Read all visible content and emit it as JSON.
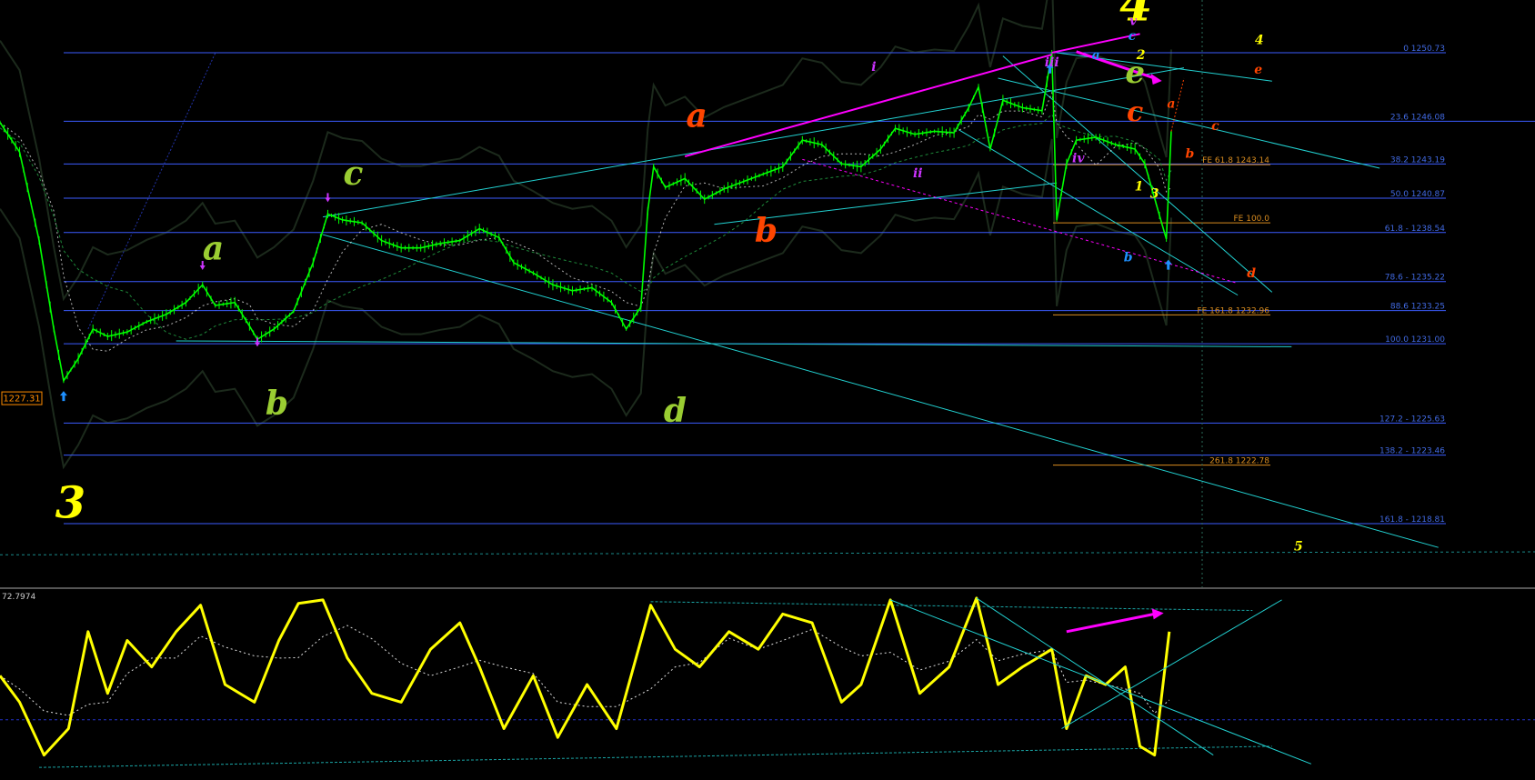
{
  "chart_data": {
    "type": "line",
    "colors": {
      "background": "#000000",
      "candles": "#00ff00",
      "fib": "#3b5bff",
      "fib_label": "#4169e1",
      "channel": "#22d3d3",
      "wave_path": "#ff00ff",
      "oscillator": "#ffff00",
      "fe": "#d98c1f",
      "price_box": "#ff8c00"
    },
    "price_pane": {
      "ylim": [
        1214.5,
        1254.3
      ],
      "fib_levels": [
        {
          "label": "0 1250.73",
          "value": 1250.73
        },
        {
          "label": "23.6 1246.08",
          "value": 1246.08
        },
        {
          "label": "38.2 1243.19",
          "value": 1243.19
        },
        {
          "label": "50.0 1240.87",
          "value": 1240.87
        },
        {
          "label": "61.8 - 1238.54",
          "value": 1238.54
        },
        {
          "label": "78.6 - 1235.22",
          "value": 1235.22
        },
        {
          "label": "88.6 1233.25",
          "value": 1233.25
        },
        {
          "label": "100.0 1231.00",
          "value": 1231.0
        },
        {
          "label": "127.2 - 1225.63",
          "value": 1225.63
        },
        {
          "label": "138.2 - 1223.46",
          "value": 1223.46
        },
        {
          "label": "161.8 - 1218.81",
          "value": 1218.81
        }
      ],
      "fe_levels": [
        {
          "label": "FE 61.8 1243.14",
          "value": 1243.14
        },
        {
          "label": "FE 100.0",
          "value": 1239.2
        },
        {
          "label": "FE 161.8 1232.96",
          "value": 1232.96
        },
        {
          "label": "261.8 1222.78",
          "value": 1222.78
        }
      ],
      "price_box": "1227.31",
      "price_series": [
        [
          0,
          1246
        ],
        [
          20,
          1244
        ],
        [
          40,
          1238
        ],
        [
          55,
          1232
        ],
        [
          65,
          1228.5
        ],
        [
          80,
          1230
        ],
        [
          95,
          1232
        ],
        [
          110,
          1231.5
        ],
        [
          130,
          1231.8
        ],
        [
          150,
          1232.5
        ],
        [
          170,
          1233
        ],
        [
          190,
          1233.8
        ],
        [
          207,
          1235
        ],
        [
          220,
          1233.6
        ],
        [
          240,
          1233.8
        ],
        [
          255,
          1232.2
        ],
        [
          263,
          1231.3
        ],
        [
          280,
          1232
        ],
        [
          300,
          1233.2
        ],
        [
          320,
          1236.5
        ],
        [
          335,
          1239.8
        ],
        [
          350,
          1239.4
        ],
        [
          370,
          1239.2
        ],
        [
          390,
          1238
        ],
        [
          410,
          1237.5
        ],
        [
          430,
          1237.5
        ],
        [
          450,
          1237.8
        ],
        [
          470,
          1238
        ],
        [
          490,
          1238.8
        ],
        [
          510,
          1238.2
        ],
        [
          525,
          1236.5
        ],
        [
          545,
          1235.8
        ],
        [
          565,
          1235
        ],
        [
          585,
          1234.6
        ],
        [
          605,
          1234.8
        ],
        [
          625,
          1233.8
        ],
        [
          640,
          1232
        ],
        [
          655,
          1233.5
        ],
        [
          662,
          1240
        ],
        [
          668,
          1243
        ],
        [
          680,
          1241.6
        ],
        [
          700,
          1242.2
        ],
        [
          720,
          1240.8
        ],
        [
          740,
          1241.5
        ],
        [
          760,
          1242
        ],
        [
          780,
          1242.5
        ],
        [
          800,
          1243
        ],
        [
          820,
          1244.8
        ],
        [
          840,
          1244.5
        ],
        [
          860,
          1243.2
        ],
        [
          880,
          1243
        ],
        [
          900,
          1244.2
        ],
        [
          915,
          1245.6
        ],
        [
          935,
          1245.2
        ],
        [
          955,
          1245.4
        ],
        [
          975,
          1245.3
        ],
        [
          990,
          1247
        ],
        [
          1000,
          1248.4
        ],
        [
          1012,
          1244.2
        ],
        [
          1025,
          1247.5
        ],
        [
          1045,
          1247
        ],
        [
          1065,
          1246.8
        ],
        [
          1075,
          1250.73
        ],
        [
          1080,
          1239.4
        ],
        [
          1090,
          1243.2
        ],
        [
          1100,
          1244.8
        ],
        [
          1120,
          1245
        ],
        [
          1140,
          1244.5
        ],
        [
          1160,
          1244.2
        ],
        [
          1170,
          1243.2
        ],
        [
          1185,
          1239.7
        ],
        [
          1192,
          1238.1
        ],
        [
          1197,
          1245.4
        ]
      ],
      "channels": [
        {
          "name": "upper-channel",
          "from": [
            330,
            1239.6
          ],
          "to": [
            1210,
            1249.7
          ]
        },
        {
          "name": "lower-channel",
          "from": [
            330,
            1238.4
          ],
          "to": [
            1470,
            1217.2
          ]
        },
        {
          "name": "right-down-channel",
          "from": [
            1020,
            1249
          ],
          "to": [
            1410,
            1242.9
          ]
        },
        {
          "name": "wedge-lower",
          "from": [
            980,
            1245.5
          ],
          "to": [
            1265,
            1234.3
          ]
        },
        {
          "name": "horizontal-support",
          "from": [
            180,
            1231.2
          ],
          "to": [
            1320,
            1230.8
          ]
        }
      ]
    },
    "oscillator_pane": {
      "value_label": "72.7974",
      "ylim": [
        0,
        100
      ],
      "values": [
        {
          "x": 0,
          "y": 55
        },
        {
          "x": 20,
          "y": 40
        },
        {
          "x": 45,
          "y": 10
        },
        {
          "x": 70,
          "y": 25
        },
        {
          "x": 90,
          "y": 80
        },
        {
          "x": 110,
          "y": 45
        },
        {
          "x": 130,
          "y": 75
        },
        {
          "x": 155,
          "y": 60
        },
        {
          "x": 180,
          "y": 80
        },
        {
          "x": 205,
          "y": 95
        },
        {
          "x": 230,
          "y": 50
        },
        {
          "x": 260,
          "y": 40
        },
        {
          "x": 285,
          "y": 75
        },
        {
          "x": 305,
          "y": 96
        },
        {
          "x": 330,
          "y": 98
        },
        {
          "x": 355,
          "y": 65
        },
        {
          "x": 380,
          "y": 45
        },
        {
          "x": 410,
          "y": 40
        },
        {
          "x": 440,
          "y": 70
        },
        {
          "x": 470,
          "y": 85
        },
        {
          "x": 490,
          "y": 60
        },
        {
          "x": 515,
          "y": 25
        },
        {
          "x": 545,
          "y": 55
        },
        {
          "x": 570,
          "y": 20
        },
        {
          "x": 600,
          "y": 50
        },
        {
          "x": 630,
          "y": 25
        },
        {
          "x": 665,
          "y": 95
        },
        {
          "x": 690,
          "y": 70
        },
        {
          "x": 715,
          "y": 60
        },
        {
          "x": 745,
          "y": 80
        },
        {
          "x": 775,
          "y": 70
        },
        {
          "x": 800,
          "y": 90
        },
        {
          "x": 830,
          "y": 85
        },
        {
          "x": 860,
          "y": 40
        },
        {
          "x": 880,
          "y": 50
        },
        {
          "x": 910,
          "y": 98
        },
        {
          "x": 940,
          "y": 45
        },
        {
          "x": 970,
          "y": 60
        },
        {
          "x": 998,
          "y": 99
        },
        {
          "x": 1020,
          "y": 50
        },
        {
          "x": 1045,
          "y": 60
        },
        {
          "x": 1075,
          "y": 70
        },
        {
          "x": 1090,
          "y": 25
        },
        {
          "x": 1110,
          "y": 55
        },
        {
          "x": 1130,
          "y": 50
        },
        {
          "x": 1150,
          "y": 60
        },
        {
          "x": 1165,
          "y": 15
        },
        {
          "x": 1180,
          "y": 10
        },
        {
          "x": 1195,
          "y": 80
        }
      ]
    },
    "wave_labels": [
      {
        "text": "3",
        "color": "#ffff00",
        "size": "large"
      },
      {
        "text": "a",
        "color": "#9acd32",
        "size": "medium"
      },
      {
        "text": "b",
        "color": "#9acd32",
        "size": "medium"
      },
      {
        "text": "c",
        "color": "#9acd32",
        "size": "medium"
      },
      {
        "text": "d",
        "color": "#9acd32",
        "size": "medium"
      },
      {
        "text": "a",
        "color": "#ff4500",
        "size": "medium"
      },
      {
        "text": "b",
        "color": "#ff4500",
        "size": "medium"
      },
      {
        "text": "4",
        "color": "#ffff00",
        "size": "large"
      },
      {
        "text": "e",
        "color": "#9acd32",
        "size": "large"
      },
      {
        "text": "c",
        "color": "#ff4500",
        "size": "large"
      },
      {
        "text": "v",
        "color": "#cc33ff",
        "size": "small"
      },
      {
        "text": "c",
        "color": "#1e90ff",
        "size": "small"
      },
      {
        "text": "a",
        "color": "#1e90ff",
        "size": "small"
      },
      {
        "text": "b",
        "color": "#1e90ff",
        "size": "small"
      },
      {
        "text": "i",
        "color": "#cc33ff",
        "size": "small"
      },
      {
        "text": "ii",
        "color": "#cc33ff",
        "size": "small"
      },
      {
        "text": "iii",
        "color": "#cc33ff",
        "size": "small"
      },
      {
        "text": "iv",
        "color": "#cc33ff",
        "size": "small"
      },
      {
        "text": "1",
        "color": "#ffff00",
        "size": "small"
      },
      {
        "text": "2",
        "color": "#ffff00",
        "size": "small"
      },
      {
        "text": "3",
        "color": "#ffff00",
        "size": "small"
      },
      {
        "text": "4",
        "color": "#ffff00",
        "size": "small"
      },
      {
        "text": "5",
        "color": "#ffff00",
        "size": "small"
      },
      {
        "text": "a",
        "color": "#ff4500",
        "size": "small"
      },
      {
        "text": "b",
        "color": "#ff4500",
        "size": "small"
      },
      {
        "text": "c",
        "color": "#ff4500",
        "size": "small"
      },
      {
        "text": "d",
        "color": "#ff4500",
        "size": "small"
      },
      {
        "text": "e",
        "color": "#ff4500",
        "size": "small"
      }
    ]
  }
}
